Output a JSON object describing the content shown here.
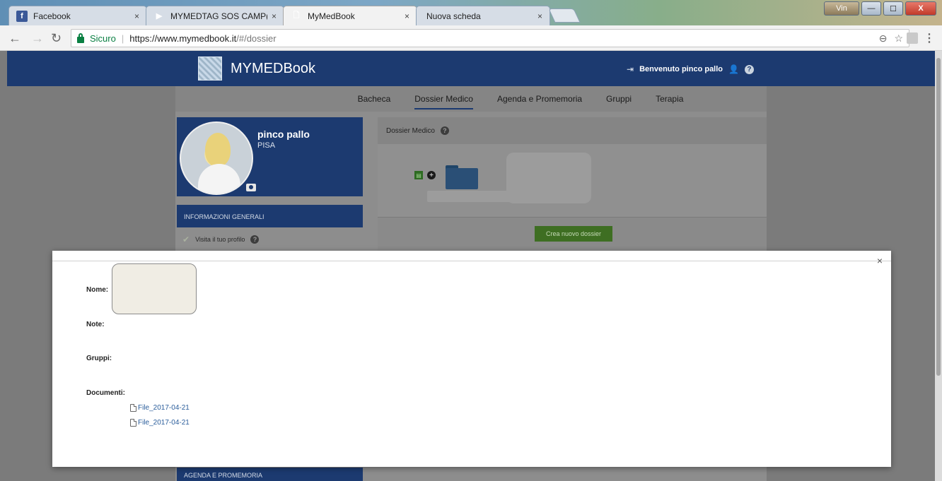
{
  "browser": {
    "tabs": [
      {
        "title": "Facebook",
        "favicon": "facebook-icon"
      },
      {
        "title": "MYMEDTAG SOS CAMP(",
        "favicon": "play-icon"
      },
      {
        "title": "MyMedBook",
        "favicon": "page-icon",
        "active": true
      },
      {
        "title": "Nuova scheda",
        "favicon": "none"
      }
    ],
    "tab_close": "×",
    "user_button": "Vin",
    "window_min": "—",
    "window_max": "☐",
    "window_close": "X",
    "secure_label": "Sicuro",
    "url_host": "https://www.mymedbook.it",
    "url_path": "/#/dossier"
  },
  "header": {
    "brand": "MYMEDBook",
    "welcome": "Benvenuto pinco pallo",
    "help": "?"
  },
  "nav": {
    "items": [
      "Bacheca",
      "Dossier Medico",
      "Agenda e Promemoria",
      "Gruppi",
      "Terapia"
    ],
    "active_index": 1
  },
  "profile": {
    "name": "pinco pallo",
    "city": "PISA"
  },
  "sidebar": {
    "info_header": "INFORMAZIONI GENERALI",
    "visit_profile": "Visita il tuo profilo",
    "agenda_header": "AGENDA E PROMEMORIA"
  },
  "dossier": {
    "title": "Dossier Medico",
    "create_button": "Crea nuovo dossier"
  },
  "modal": {
    "close": "×",
    "name_label": "Nome:",
    "name_value": "",
    "notes_label": "Note:",
    "groups_label": "Gruppi:",
    "documents_label": "Documenti:",
    "documents": [
      "File_2017-04-21",
      "File_2017-04-21"
    ]
  },
  "colors": {
    "brand_blue": "#1c3a70",
    "button_green": "#3e6e22",
    "link_blue": "#2a5d9b"
  }
}
